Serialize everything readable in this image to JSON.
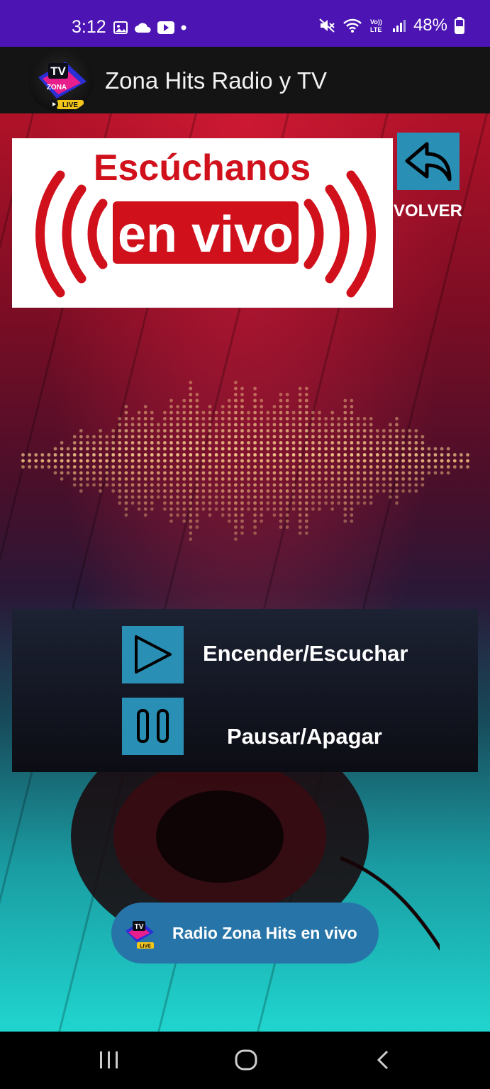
{
  "status_bar": {
    "time": "3:12",
    "battery": "48%"
  },
  "app_bar": {
    "title": "Zona Hits Radio y TV",
    "logo_tv": "TV",
    "logo_zona": "ZONA",
    "logo_live": "LIVE"
  },
  "banner": {
    "line1": "Escúchanos",
    "line2": "en vivo"
  },
  "volver": {
    "label": "VOLVER"
  },
  "controls": {
    "play_label": "Encender/Escuchar",
    "pause_label": "Pausar/Apagar"
  },
  "chip": {
    "label": "Radio Zona Hits en vivo",
    "logo_tv": "TV",
    "logo_live": "LIVE"
  },
  "colors": {
    "status_bar": "#4b14b3",
    "button_blue": "#2a8fb5",
    "chip_blue": "#2775a8",
    "banner_red": "#d0111c"
  }
}
